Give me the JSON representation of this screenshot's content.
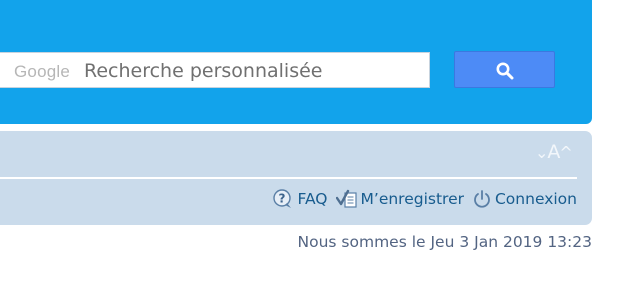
{
  "search": {
    "brand": "Google",
    "placeholder": "Recherche personnalisée",
    "button_icon": "search-icon"
  },
  "font_resize": {
    "decrease": "⌄",
    "label": "A",
    "increase": "^"
  },
  "nav": {
    "faq": {
      "label": "FAQ",
      "icon": "faq-icon"
    },
    "register": {
      "label": "M’enregistrer",
      "icon": "register-icon"
    },
    "login": {
      "label": "Connexion",
      "icon": "power-icon"
    }
  },
  "status": {
    "date_text": "Nous sommes le Jeu 3 Jan 2019 13:23"
  },
  "colors": {
    "header": "#12a3eb",
    "navbar": "#cadbeb",
    "search_button": "#4d8bf6",
    "link": "#185c8e",
    "date_text": "#536482"
  }
}
